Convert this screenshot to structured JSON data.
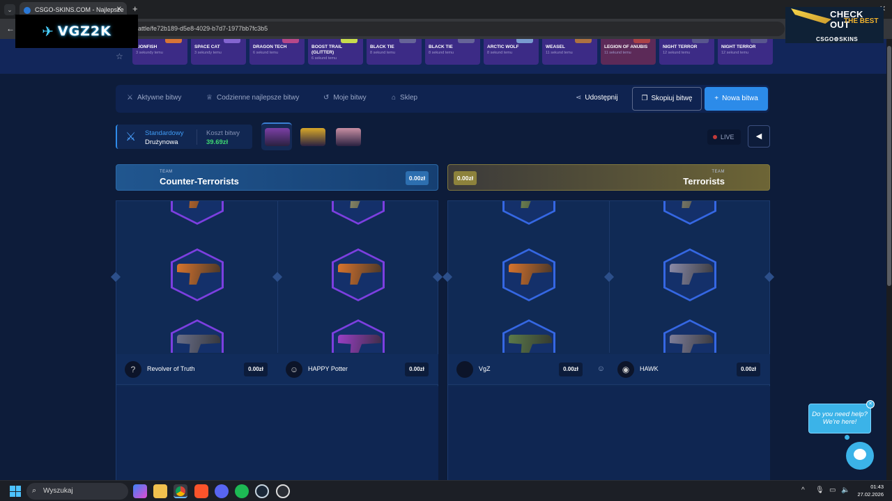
{
  "browser": {
    "tab_title": "CSGO-SKINS.COM - Najlepsze",
    "url": "attle/fe72b189-d5e8-4029-b7d7-1977bb7fc3b5"
  },
  "overlay": {
    "logo_text": "VGZ2K"
  },
  "ad": {
    "line1": "CHECK OUT",
    "line2": "THE BEST",
    "brand": "CSGO⚙SKINS"
  },
  "live_drops": [
    {
      "name": "LIONFISH",
      "time": "3 sekundy temu",
      "color": "#e87d2e"
    },
    {
      "name": "SPACE CAT",
      "time": "3 sekundy temu",
      "color": "#8c6bd8"
    },
    {
      "name": "DRAGON TECH",
      "time": "6 sekund temu",
      "color": "#c44b8a"
    },
    {
      "name": "BOOST TRAIL (GLITTER)",
      "time": "6 sekund temu",
      "color": "#d6f047"
    },
    {
      "name": "BLACK TIE",
      "time": "8 sekund temu",
      "color": "#6a6a9a"
    },
    {
      "name": "BLACK TIE",
      "time": "8 sekund temu",
      "color": "#6a6a9a"
    },
    {
      "name": "ARCTIC WOLF",
      "time": "8 sekund temu",
      "color": "#7fa7d8"
    },
    {
      "name": "WEASEL",
      "time": "11 sekund temu",
      "color": "#b97a3a"
    },
    {
      "name": "LEGION OF ANUBIS",
      "time": "11 sekund temu",
      "color": "#b54545"
    },
    {
      "name": "NIGHT TERROR",
      "time": "12 sekund temu",
      "color": "#5b5b8f"
    },
    {
      "name": "NIGHT TERROR",
      "time": "12 sekund temu",
      "color": "#5b5b8f"
    }
  ],
  "nav": {
    "active_battles": "Aktywne bitwy",
    "daily_best": "Codzienne najlepsze bitwy",
    "my_battles": "Moje bitwy",
    "shop": "Sklep",
    "share": "Udostępnij",
    "copy_battle": "Skopiuj bitwę",
    "new_battle": "Nowa bitwa"
  },
  "battle": {
    "mode_label": "Standardowy",
    "mode_type": "Drużynowa",
    "cost_label": "Koszt bitwy",
    "cost_value": "39.69zł",
    "live_label": "LIVE",
    "cases": [
      {
        "color": "#7b3fa5"
      },
      {
        "color": "#d8a829"
      },
      {
        "color": "#c88fa3"
      }
    ]
  },
  "teams": {
    "ct": {
      "tag": "TEAM",
      "name": "Counter-Terrorists",
      "value": "0.00zł"
    },
    "t": {
      "tag": "TEAM",
      "name": "Terrorists",
      "value": "0.00zł"
    }
  },
  "players": [
    {
      "name": "Revolver of Truth",
      "value": "0.00zł",
      "avatar": "?",
      "frame": "purple",
      "guns": [
        "#d8742c",
        "#d8742c",
        "#6a6f8a"
      ]
    },
    {
      "name": "HAPPY Potter",
      "value": "0.00zł",
      "avatar": "☺",
      "frame": "purple",
      "guns": [
        "#a2a37a",
        "#d8742c",
        "#9b3fc6"
      ]
    },
    {
      "name": "VgZ",
      "value": "0.00zł",
      "avatar": "",
      "frame": "blue",
      "guns": [
        "#7f9a5c",
        "#d8742c",
        "#5c7a4a"
      ]
    },
    {
      "name": "HAWK",
      "value": "0.00zł",
      "avatar": "◉",
      "frame": "blue",
      "guns": [
        "#8f8f7a",
        "#8a8aa8",
        "#7e7e9a"
      ]
    }
  ],
  "chat": {
    "help_line1": "Do you need help?",
    "help_line2": "We're here!"
  },
  "taskbar": {
    "search": "Wyszukaj",
    "time": "01:43",
    "date": "27.02.2026"
  }
}
